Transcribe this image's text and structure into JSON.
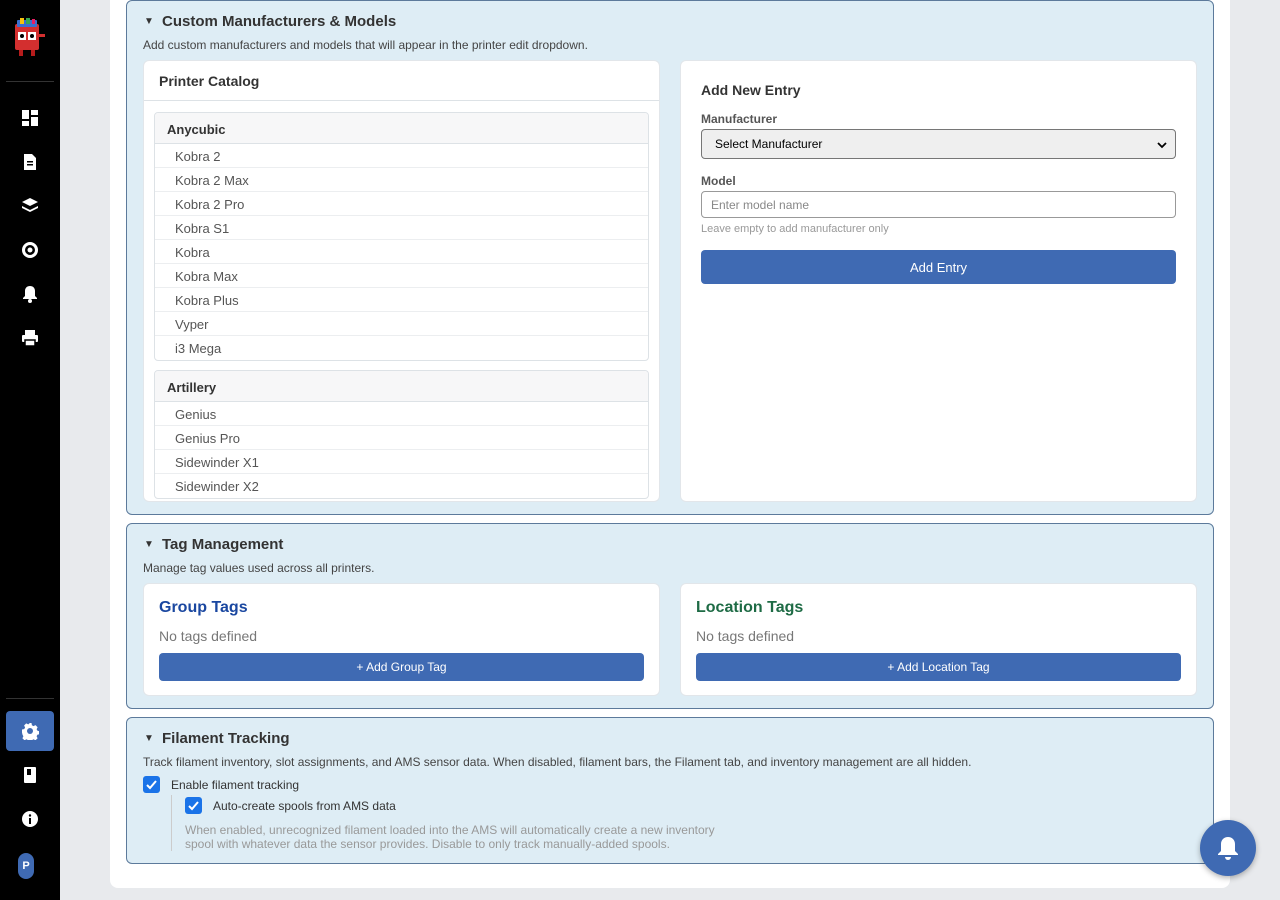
{
  "sidebar": {
    "logo_icon": "printer-mascot-logo",
    "nav": [
      {
        "name": "dashboard-icon"
      },
      {
        "name": "document-icon"
      },
      {
        "name": "layers-icon"
      },
      {
        "name": "filament-spool-icon"
      },
      {
        "name": "bell-icon"
      },
      {
        "name": "printer-icon"
      }
    ],
    "bottom_nav": [
      {
        "name": "gear-icon",
        "active": true
      },
      {
        "name": "book-icon"
      },
      {
        "name": "info-icon"
      }
    ],
    "avatar_initial": "P"
  },
  "custom_mfr": {
    "title": "Custom Manufacturers & Models",
    "description": "Add custom manufacturers and models that will appear in the printer edit dropdown.",
    "catalog": {
      "title": "Printer Catalog",
      "groups": [
        {
          "name": "Anycubic",
          "models": [
            "Kobra 2",
            "Kobra 2 Max",
            "Kobra 2 Pro",
            "Kobra S1",
            "Kobra",
            "Kobra Max",
            "Kobra Plus",
            "Vyper",
            "i3 Mega"
          ]
        },
        {
          "name": "Artillery",
          "models": [
            "Genius",
            "Genius Pro",
            "Sidewinder X1",
            "Sidewinder X2"
          ]
        }
      ]
    },
    "form": {
      "title": "Add New Entry",
      "manufacturer_label": "Manufacturer",
      "manufacturer_value": "Select Manufacturer",
      "model_label": "Model",
      "model_placeholder": "Enter model name",
      "hint": "Leave empty to add manufacturer only",
      "add_button": "Add Entry"
    }
  },
  "tags": {
    "title": "Tag Management",
    "description": "Manage tag values used across all printers.",
    "group": {
      "title": "Group Tags",
      "empty": "No tags defined",
      "button": "+ Add Group Tag",
      "color": "#1a47a0"
    },
    "location": {
      "title": "Location Tags",
      "empty": "No tags defined",
      "button": "+ Add Location Tag",
      "color": "#1e6b45"
    }
  },
  "filament": {
    "title": "Filament Tracking",
    "description": "Track filament inventory, slot assignments, and AMS sensor data. When disabled, filament bars, the Filament tab, and inventory management are all hidden.",
    "enable_label": "Enable filament tracking",
    "enable_checked": true,
    "auto_label": "Auto-create spools from AMS data",
    "auto_checked": true,
    "auto_description": "When enabled, unrecognized filament loaded into the AMS will automatically create a new inventory spool with whatever data the sensor provides. Disable to only track manually-added spools."
  },
  "fab": {
    "icon": "bell-icon"
  },
  "colors": {
    "accent": "#3f6ab3",
    "section_bg": "#deedf5",
    "checkbox": "#1a73e8"
  }
}
